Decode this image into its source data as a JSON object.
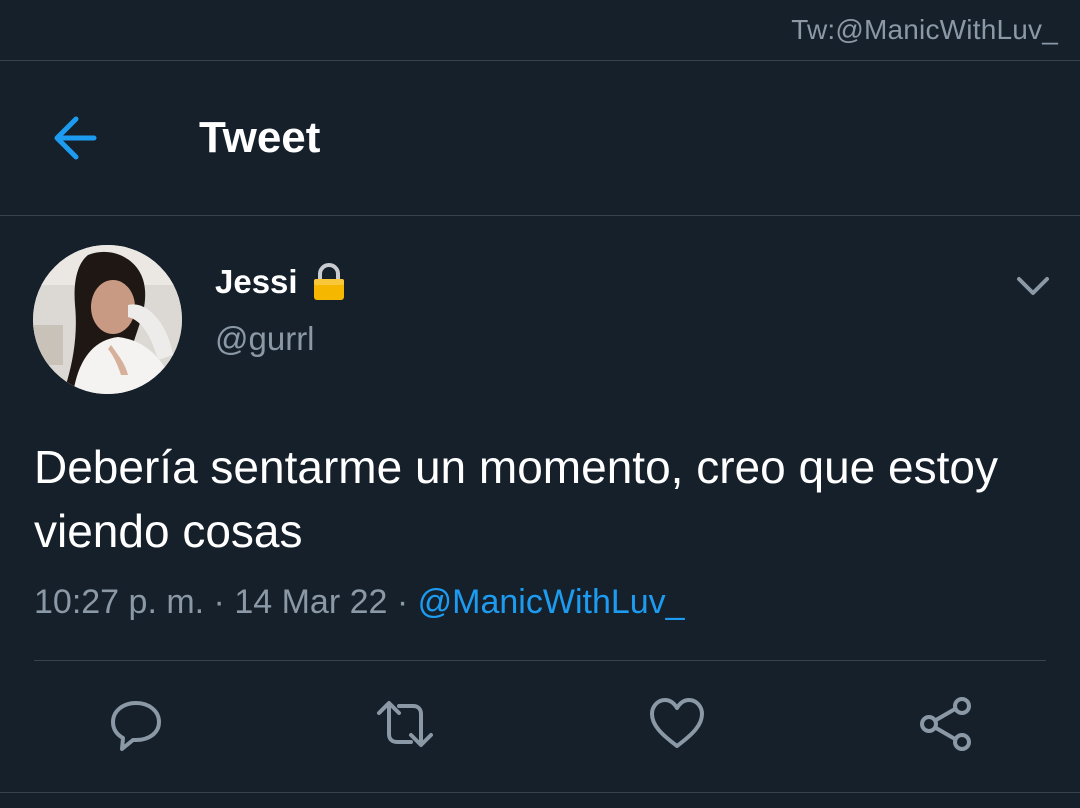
{
  "watermark": "Tw:@ManicWithLuv_",
  "header": {
    "back_icon": "arrow-left-icon",
    "title": "Tweet"
  },
  "tweet": {
    "author": {
      "display_name": "Jessi",
      "protected_icon": "lock-icon",
      "handle": "@gurrl"
    },
    "text": "Debería sentarme un momento, creo que estoy viendo cosas",
    "time": "10:27 p. m.",
    "sep1": " · ",
    "date": "14 Mar 22",
    "sep2": " · ",
    "source": "@ManicWithLuv_"
  },
  "actions": [
    "reply-icon",
    "retweet-icon",
    "like-icon",
    "share-icon"
  ],
  "colors": {
    "background": "#15202b",
    "divider": "#38444d",
    "accent": "#1d9bf0",
    "muted": "#8b98a5",
    "lock": "#f5b700"
  }
}
